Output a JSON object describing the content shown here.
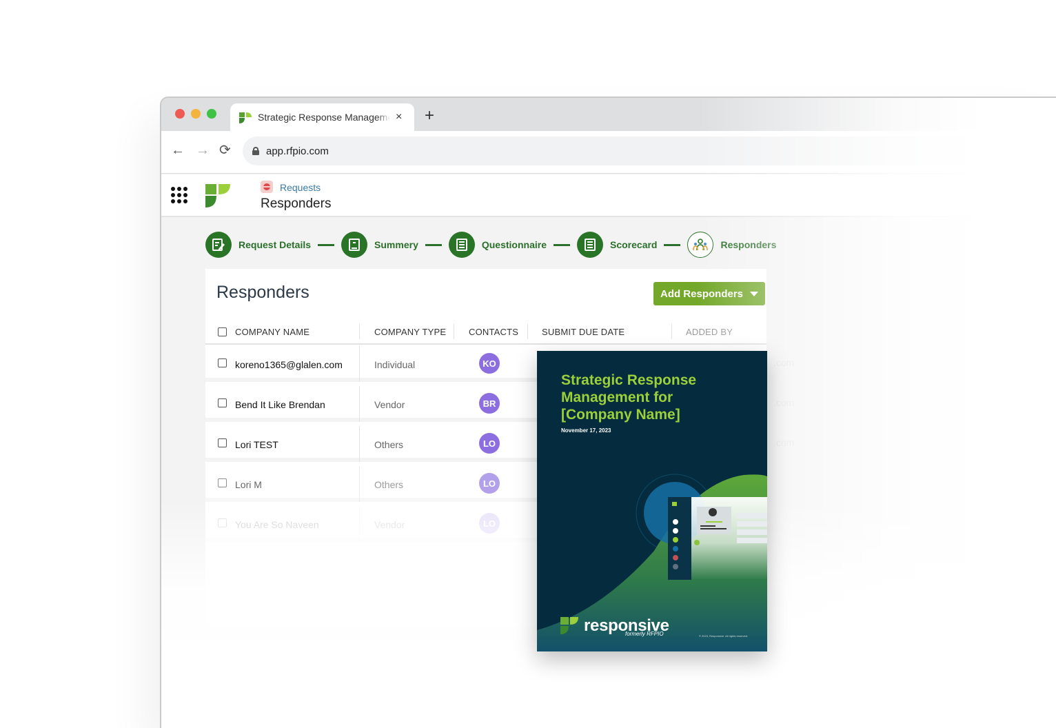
{
  "browser": {
    "tab_title": "Strategic Response Management",
    "tab_close": "×",
    "new_tab": "+",
    "url": "app.rfpio.com",
    "nav": {
      "back": "←",
      "forward": "→",
      "reload": "⟳"
    }
  },
  "header": {
    "breadcrumb_link": "Requests",
    "page_title": "Responders"
  },
  "stepper": {
    "steps": [
      {
        "label": "Request Details",
        "icon": "edit-document-icon",
        "state": "complete"
      },
      {
        "label": "Summery",
        "icon": "summary-document-icon",
        "state": "complete"
      },
      {
        "label": "Questionnaire",
        "icon": "list-document-icon",
        "state": "complete"
      },
      {
        "label": "Scorecard",
        "icon": "list-document-icon",
        "state": "complete"
      },
      {
        "label": "Responders",
        "icon": "people-icon",
        "state": "current"
      }
    ]
  },
  "card": {
    "title": "Responders",
    "add_button": "Add Responders",
    "columns": [
      "COMPANY NAME",
      "COMPANY TYPE",
      "CONTACTS",
      "SUBMIT DUE DATE",
      "ADDED BY"
    ],
    "rows": [
      {
        "name": "koreno1365@glalen.com",
        "type": "Individual",
        "contact_initials": "KO"
      },
      {
        "name": "Bend It Like Brendan",
        "type": "Vendor",
        "contact_initials": "BR"
      },
      {
        "name": "Lori TEST",
        "type": "Others",
        "contact_initials": "LO"
      },
      {
        "name": "Lori M",
        "type": "Others",
        "contact_initials": "LO"
      },
      {
        "name": "You Are So Naveen",
        "type": "Vendor",
        "contact_initials": "LO"
      }
    ],
    "ghost_text": ".com"
  },
  "cover": {
    "title": "Strategic Response Management for [Company Name]",
    "date": "November 17, 2023",
    "brand": "responsive",
    "brand_sub": "formerly RFPIO",
    "copyright": "© 2023, Responsive. All rights reserved."
  },
  "colors": {
    "brand_green": "#74a82b",
    "step_green": "#2a7427",
    "avatar_purple": "#8c6ee0",
    "cover_navy": "#052b3e",
    "cover_title_green": "#9bd03a"
  }
}
